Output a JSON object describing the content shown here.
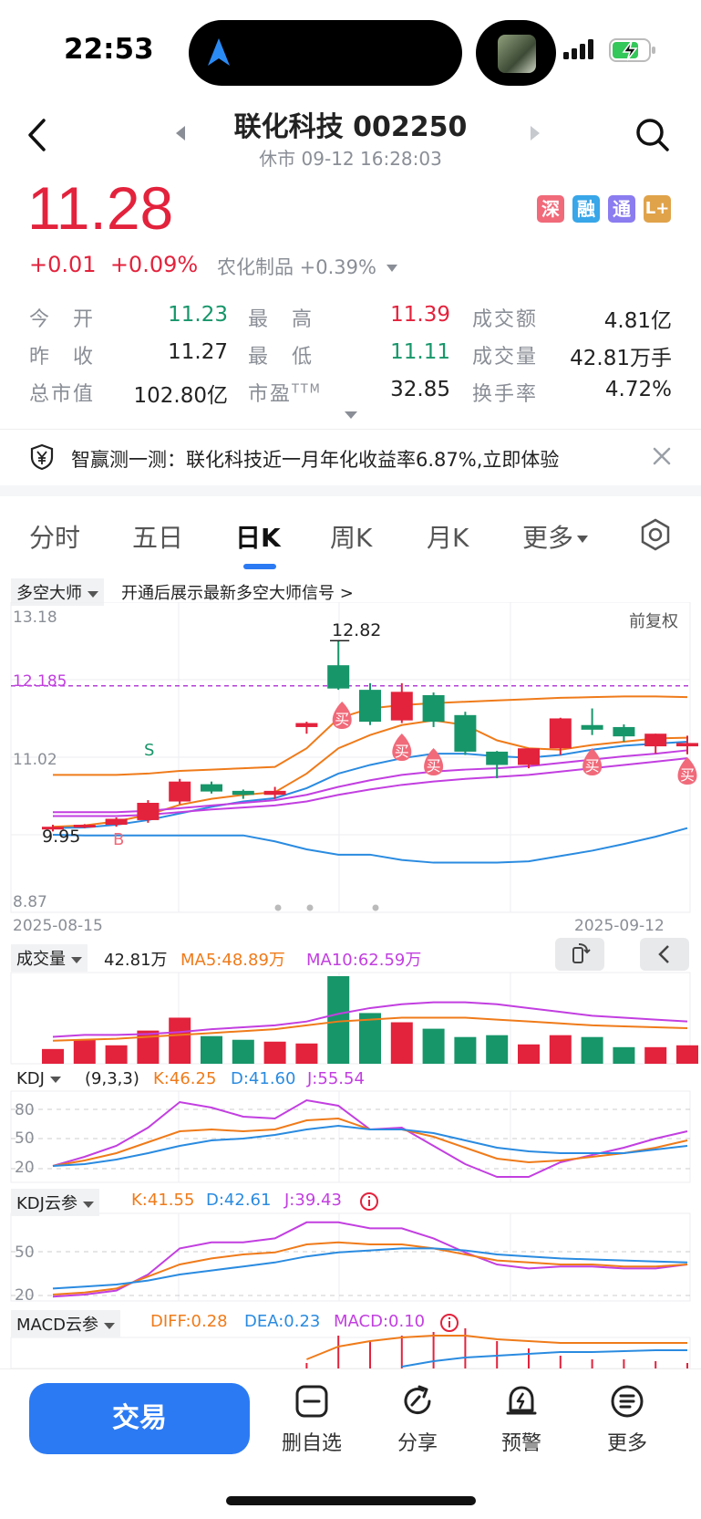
{
  "status": {
    "time": "22:53"
  },
  "header": {
    "title": "联化科技 002250",
    "subtitle": "休市 09-12 16:28:03"
  },
  "quote": {
    "price": "11.28",
    "change": "+0.01",
    "change_pct": "+0.09%",
    "sector": "农化制品 +0.39%",
    "badges": [
      "深",
      "融",
      "通",
      "L+"
    ]
  },
  "stats": [
    {
      "label": "今开",
      "value": "11.23",
      "color": "down"
    },
    {
      "label": "最高",
      "value": "11.39",
      "color": "up"
    },
    {
      "label": "成交额",
      "value": "4.81亿",
      "color": ""
    },
    {
      "label": "昨收",
      "value": "11.27",
      "color": ""
    },
    {
      "label": "最低",
      "value": "11.11",
      "color": "down"
    },
    {
      "label": "成交量",
      "value": "42.81万手",
      "color": ""
    },
    {
      "label": "总市值",
      "value": "102.80亿",
      "color": ""
    },
    {
      "label": "市盈TTM",
      "value": "32.85",
      "color": ""
    },
    {
      "label": "换手率",
      "value": "4.72%",
      "color": ""
    }
  ],
  "stat_labels_display": {
    "jin_kai": "今　开",
    "zui_gao": "最　高",
    "zuo_shou": "昨　收",
    "zui_di": "最　低",
    "shi_ying": "市盈",
    "ttm": "TTM"
  },
  "promo": {
    "text": "智赢测一测：联化科技近一月年化收益率6.87%,立即体验"
  },
  "tabs": [
    "分时",
    "五日",
    "日K",
    "周K",
    "月K",
    "更多"
  ],
  "active_tab": "日K",
  "kline": {
    "indicator": "多空大师",
    "promo": "开通后展示最新多空大师信号 >",
    "adjust": "前复权",
    "y_labels": [
      "13.18",
      "12.185",
      "11.02",
      "9.95",
      "8.87"
    ],
    "y_marker": "12.14",
    "max_label": "12.82",
    "min_label": "9.95",
    "date_start": "2025-08-15",
    "date_end": "2025-09-12",
    "signal_s": "S",
    "signal_b": "B",
    "signal_buy": "买"
  },
  "volume": {
    "label": "成交量",
    "value": "42.81万",
    "ma5": "MA5:48.89万",
    "ma10": "MA10:62.59万"
  },
  "kdj": {
    "label": "KDJ",
    "params": "(9,3,3)",
    "k": "K:46.25",
    "d": "D:41.60",
    "j": "J:55.54",
    "levels": [
      "80",
      "50",
      "20"
    ]
  },
  "kdj_cloud": {
    "label": "KDJ云参",
    "k": "K:41.55",
    "d": "D:42.61",
    "j": "J:39.43",
    "levels": [
      "50",
      "20"
    ]
  },
  "macd_cloud": {
    "label": "MACD云参",
    "diff": "DIFF:0.28",
    "dea": "DEA:0.23",
    "macd": "MACD:0.10"
  },
  "bottom_bar": {
    "trade": "交易",
    "items": [
      "删自选",
      "分享",
      "预警",
      "更多"
    ]
  },
  "colors": {
    "up": "#e3223c",
    "down": "#17966a",
    "accent": "#2b7af3",
    "ma_orange": "#ef7b1a",
    "ma_blue": "#2a8be0",
    "ma_purple": "#c23fe0"
  },
  "chart_data": {
    "type": "candlestick",
    "x": [
      "08-15",
      "08-18",
      "08-19",
      "08-20",
      "08-21",
      "08-22",
      "08-25",
      "08-26",
      "08-27",
      "08-28",
      "08-29",
      "09-01",
      "09-02",
      "09-03",
      "09-04",
      "09-05",
      "09-08",
      "09-09",
      "09-10",
      "09-11",
      "09-12"
    ],
    "ohlc": [
      [
        9.98,
        10.05,
        9.95,
        10.02
      ],
      [
        10.02,
        10.06,
        10.0,
        10.05
      ],
      [
        10.05,
        10.16,
        10.02,
        10.14
      ],
      [
        10.12,
        10.42,
        10.08,
        10.38
      ],
      [
        10.4,
        10.74,
        10.36,
        10.7
      ],
      [
        10.66,
        10.7,
        10.52,
        10.55
      ],
      [
        10.56,
        10.58,
        10.44,
        10.5
      ],
      [
        10.5,
        10.62,
        10.44,
        10.56
      ],
      [
        11.52,
        11.6,
        11.42,
        11.58
      ],
      [
        12.45,
        12.82,
        12.08,
        12.1
      ],
      [
        12.08,
        12.18,
        11.55,
        11.6
      ],
      [
        11.62,
        12.18,
        11.58,
        12.05
      ],
      [
        12.0,
        12.04,
        11.52,
        11.6
      ],
      [
        11.7,
        11.75,
        11.1,
        11.15
      ],
      [
        11.15,
        11.16,
        10.75,
        10.95
      ],
      [
        10.95,
        11.2,
        10.9,
        11.2
      ],
      [
        11.2,
        11.66,
        11.1,
        11.65
      ],
      [
        11.55,
        11.8,
        11.4,
        11.48
      ],
      [
        11.52,
        11.56,
        11.3,
        11.38
      ],
      [
        11.23,
        11.42,
        11.12,
        11.42
      ],
      [
        11.23,
        11.39,
        11.11,
        11.28
      ]
    ],
    "volume": [
      16,
      26,
      20,
      36,
      50,
      30,
      26,
      24,
      22,
      95,
      55,
      45,
      38,
      29,
      31,
      21,
      31,
      29,
      18,
      18,
      20
    ],
    "ylim": [
      8.87,
      13.18
    ]
  }
}
